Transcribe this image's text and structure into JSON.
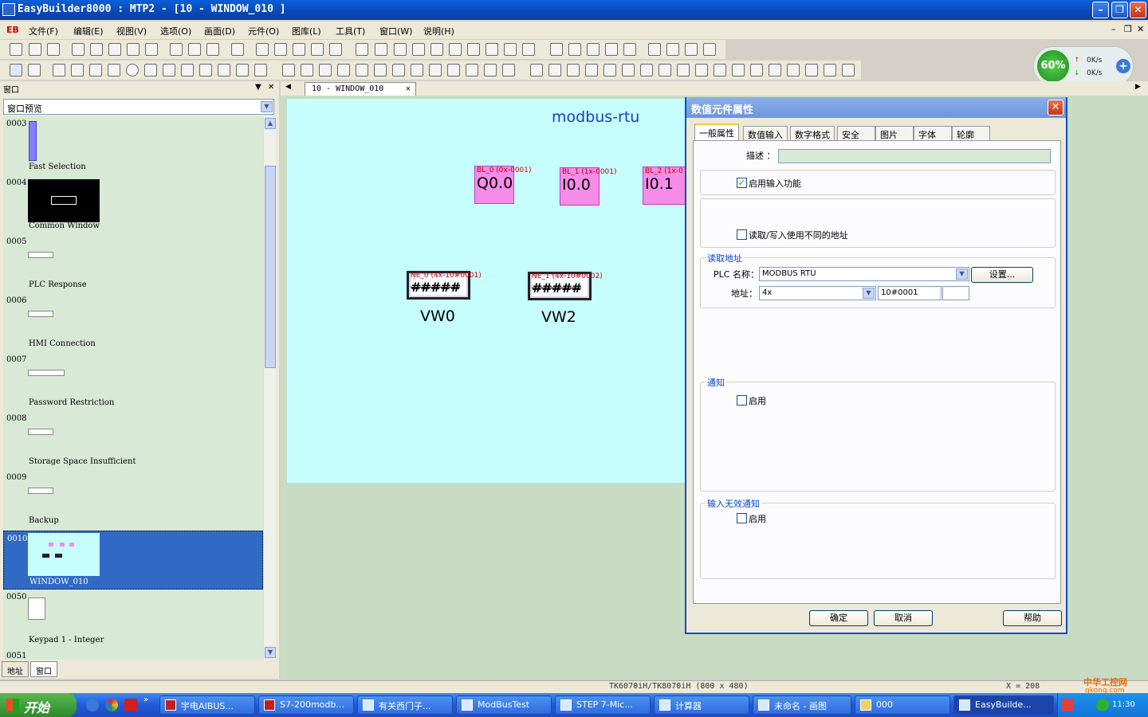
{
  "window": {
    "title": "EasyBuilder8000 : MTP2 - [10 - WINDOW_010 ]",
    "min": "–",
    "max": "❐",
    "close": "✕"
  },
  "menubar": {
    "logo": "EB",
    "items": [
      "文件(F)",
      "编辑(E)",
      "视图(V)",
      "选项(O)",
      "画面(D)",
      "元件(O)",
      "图库(L)",
      "工具(T)",
      "窗口(W)",
      "说明(H)"
    ],
    "mdi": [
      "–",
      "❐",
      "✕"
    ]
  },
  "netwidget": {
    "percent": "60%",
    "up": "0K/s",
    "down": "0K/s",
    "plus": "+"
  },
  "leftpanel": {
    "header": "窗口",
    "select_value": "窗口预览",
    "items": [
      {
        "num": "0003",
        "name": "Fast Selection"
      },
      {
        "num": "0004",
        "name": "Common Window"
      },
      {
        "num": "0005",
        "name": "PLC Response"
      },
      {
        "num": "0006",
        "name": "HMI Connection"
      },
      {
        "num": "0007",
        "name": "Password Restriction"
      },
      {
        "num": "0008",
        "name": "Storage Space Insufficient"
      },
      {
        "num": "0009",
        "name": "Backup"
      },
      {
        "num": "0010",
        "name": "WINDOW_010"
      },
      {
        "num": "0050",
        "name": "Keypad 1 - Integer"
      },
      {
        "num": "0051",
        "name": ""
      }
    ],
    "tabs": [
      "地址",
      "窗口"
    ]
  },
  "doctab": {
    "label": "10 - WINDOW_010",
    "close": "✕"
  },
  "screen": {
    "title": "modbus-rtu",
    "bitlamps": [
      {
        "label": "BL_0 (0x-0001)",
        "value": "Q0.0"
      },
      {
        "label": "BL_1 (1x-0001)",
        "value": "I0.0"
      },
      {
        "label": "BL_2 (1x-0",
        "value": "I0.1"
      }
    ],
    "numdisplays": [
      {
        "label": "NE_0 (4x-10#0001)",
        "value": "#####",
        "caption": "VW0"
      },
      {
        "label": "NE_1 (4x-10#0002)",
        "value": "#####",
        "caption": "VW2"
      }
    ]
  },
  "dialog": {
    "title": "数值元件属性",
    "tabs": [
      "一般属性",
      "数值输入",
      "数字格式",
      "安全",
      "图片",
      "字体",
      "轮廓"
    ],
    "desc_label": "描述 ：",
    "desc_value": "",
    "enable_input": {
      "label": "启用输入功能",
      "checked": "✓"
    },
    "diff_addr": {
      "label": "读取/写入使用不同的地址"
    },
    "read_group": {
      "title": "读取地址",
      "plc_label": "PLC 名称：",
      "plc_value": "MODBUS RTU",
      "settings_button": "设置...",
      "addr_label": "地址：",
      "addr_type": "4x",
      "addr_value": "10#0001"
    },
    "notify_group": {
      "title": "通知",
      "enable": "启用"
    },
    "invalid_group": {
      "title": "输入无效通知",
      "enable": "启用"
    },
    "buttons": {
      "ok": "确定",
      "cancel": "取消",
      "help": "帮助"
    }
  },
  "statusbar": {
    "model": "TK6070iH/TK8070iH (800 x 480)",
    "coord": "X = 208"
  },
  "taskbar": {
    "start": "开始",
    "tasks": [
      "宇电AIBUS...",
      "S7-200modb...",
      "有关西门子...",
      "ModBusTest",
      "STEP 7-Mic...",
      "计算器",
      "未命名 - 画图",
      "000",
      "EasyBuilde..."
    ],
    "clock": "11:30",
    "watermark": "中华工控网",
    "watermark_url": "gkong.com"
  }
}
